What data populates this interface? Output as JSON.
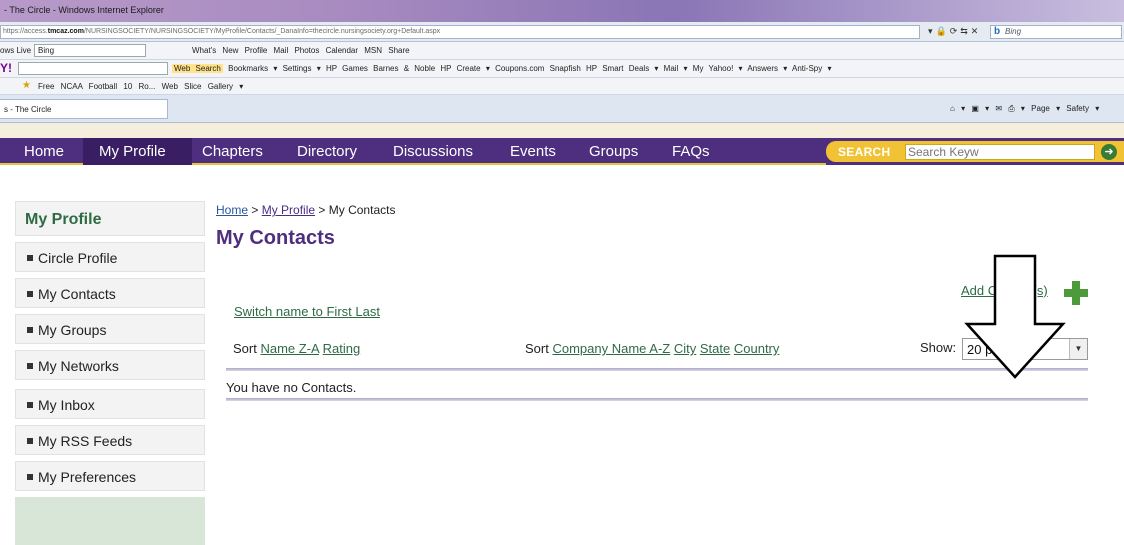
{
  "browser": {
    "title": "- The Circle - Windows Internet Explorer",
    "url_prefix": "https://access.",
    "url_host": "tmcaz.com",
    "url_rest": "/NURSINGSOCIETY/NURSINGSOCIETY/MyProfile/Contacts/_DanaInfo=thecircle.nursingsociety.org+Default.aspx",
    "search_provider": "Bing",
    "livebar_label": "ows Live",
    "livebar_search": "Bing",
    "livebar_links": "What's New   Profile   Mail   Photos   Calendar   MSN   Share",
    "yahoo_logo": "Y!",
    "yahoo_web_search": "Web Search",
    "yahoo_links": "Bookmarks ▾  Settings ▾  HP Games  Barnes & Noble  HP Create ▾  Coupons.com  Snapfish  HP Smart Deals ▾  Mail ▾  My Yahoo! ▾  Answers ▾  Anti-Spy ▾",
    "favorites": "Free NCAA Football 10 Ro...   Web Slice Gallery ▾",
    "tab_title": "s - The Circle",
    "tools": "Page ▾  Safety ▾"
  },
  "nav": {
    "items": [
      "Home",
      "My Profile",
      "Chapters",
      "Directory",
      "Discussions",
      "Events",
      "Groups",
      "FAQs"
    ],
    "active": "My Profile",
    "search_label": "SEARCH",
    "search_placeholder": "Search Keyw"
  },
  "sidebar": {
    "title": "My Profile",
    "items": [
      "Circle Profile",
      "My Contacts",
      "My Groups",
      "My Networks",
      "My Inbox",
      "My RSS Feeds",
      "My Preferences"
    ]
  },
  "main": {
    "breadcrumb": [
      "Home",
      "My Profile",
      "My Contacts"
    ],
    "breadcrumb_sep": ">",
    "heading": "My Contacts",
    "add_contacts": "Add Contact(s)",
    "switch_name": "Switch name to First Last",
    "sort_label": "Sort",
    "sort_name": "Name Z-A",
    "sort_rating": "Rating",
    "sort_company": "Company Name A-Z",
    "sort_city": "City",
    "sort_state": "State",
    "sort_country": "Country",
    "show_label": "Show:",
    "show_value": "20 per page",
    "empty_message": "You have no Contacts."
  }
}
